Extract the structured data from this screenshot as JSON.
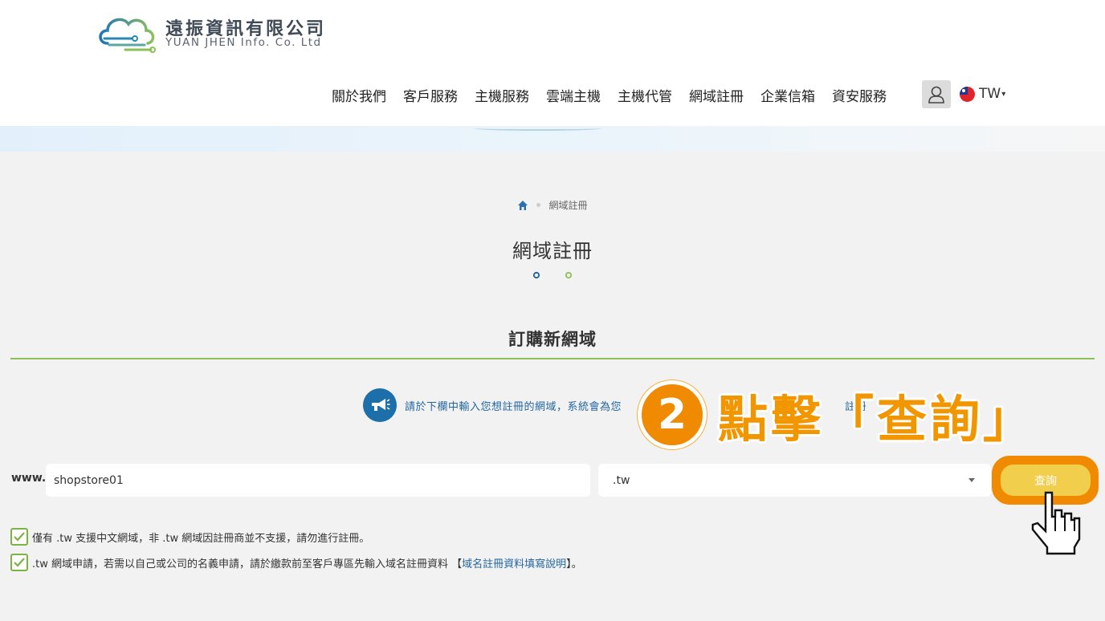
{
  "header": {
    "company_cn": "遠振資訊有限公司",
    "company_en": "YUAN JHEN Info. Co. Ltd",
    "nav": [
      "關於我們",
      "客戶服務",
      "主機服務",
      "雲端主機",
      "主機代管",
      "網域註冊",
      "企業信箱",
      "資安服務"
    ],
    "lang": "TW"
  },
  "breadcrumb": {
    "current": "網域註冊"
  },
  "page_title": "網域註冊",
  "section_title": "訂購新網域",
  "notice": {
    "text": "請於下欄中輸入您想註冊的網域，系統會為您",
    "text_tail": "註冊"
  },
  "callout": {
    "number": "2",
    "text": "點擊「查詢」"
  },
  "form": {
    "www_label": "www.",
    "domain_value": "shopstore01",
    "tld_selected": ".tw",
    "query_label": "查詢"
  },
  "notes": {
    "note1": "僅有 .tw 支援中文網域，非 .tw 網域因註冊商並不支援，請勿進行註冊。",
    "note2_pre": ".tw 網域申請，若需以自己或公司的名義申請，請於繳款前至客戶專區先輸入域名註冊資料 【",
    "note2_link": "域名註冊資料填寫說明",
    "note2_post": "】。"
  },
  "colors": {
    "accent_blue": "#1d6fa9",
    "accent_green": "#8cc15a",
    "callout_orange": "#f29600",
    "query_button": "#f1cf4c"
  }
}
